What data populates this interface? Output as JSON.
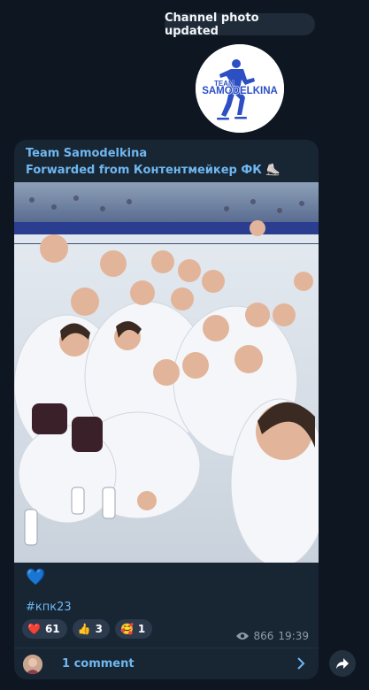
{
  "service_message": "Channel photo updated",
  "channel_logo": {
    "line1": "TEAM",
    "line2": "SAMODELKINA",
    "color": "#2c4fc4"
  },
  "post": {
    "sender": "Team Samodelkina",
    "forwarded_from": "Forwarded from Контентмейкер ФК ⛸️",
    "photo_icon": "group-selfie-photo",
    "body_emoji": "💙",
    "hashtag": "#кпк23",
    "reactions": [
      {
        "emoji": "❤️",
        "count": "61"
      },
      {
        "emoji": "👍",
        "count": "3"
      },
      {
        "emoji": "🥰",
        "count": "1"
      }
    ],
    "views": "866",
    "time": "19:39",
    "comments_label": "1 comment"
  },
  "colors": {
    "accent": "#6fb7f0",
    "background": "#0e1621",
    "bubble": "#182533"
  }
}
